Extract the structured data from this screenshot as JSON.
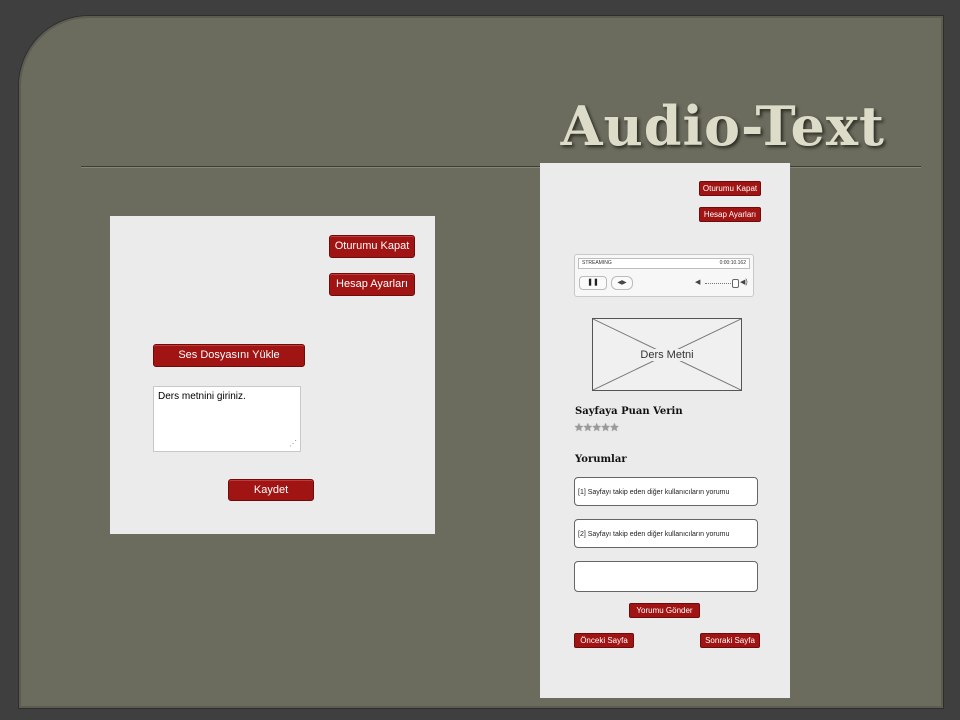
{
  "slide": {
    "title": "Audio-Text"
  },
  "mock1": {
    "logout_label": "Oturumu Kapat",
    "settings_label": "Hesap Ayarları",
    "upload_label": "Ses Dosyasını Yükle",
    "textarea_value": "Ders metnini giriniz.",
    "save_label": "Kaydet"
  },
  "mock2": {
    "logout_label": "Oturumu Kapat",
    "settings_label": "Hesap Ayarları",
    "player": {
      "status": "STREAMING",
      "time": "0:00:10.162",
      "pause_symbol": "❚❚"
    },
    "text_placeholder": "Ders Metni",
    "rating_heading": "Sayfaya Puan Verin",
    "rating": {
      "stars": "★★★★★",
      "max": 5,
      "value": 0
    },
    "comments_heading": "Yorumlar",
    "comments": [
      "[1] Sayfayı takip eden diğer kullanıcıların yorumu",
      "[2] Sayfayı takip eden diğer kullanıcıların yorumu"
    ],
    "send_label": "Yorumu Gönder",
    "prev_label": "Önceki Sayfa",
    "next_label": "Sonraki Sayfa"
  },
  "colors": {
    "slide_bg": "#6b6c5e",
    "button_red": "#a01414",
    "panel_bg": "#ebebeb"
  }
}
